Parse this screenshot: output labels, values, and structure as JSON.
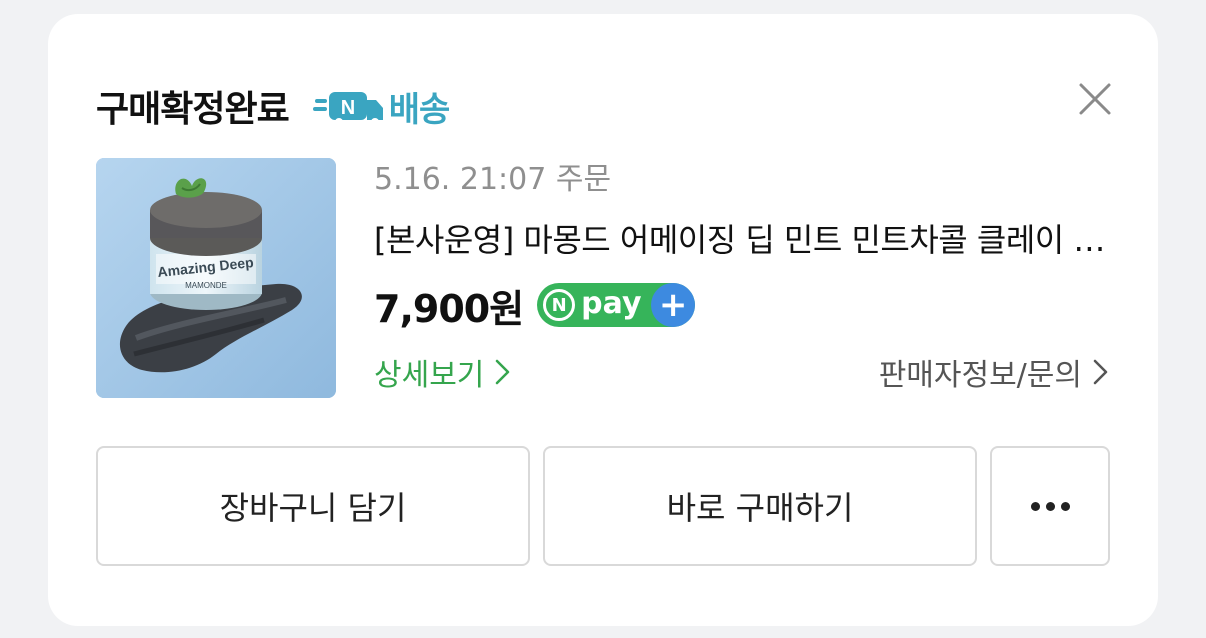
{
  "header": {
    "status_title": "구매확정완료",
    "delivery_badge": {
      "icon": "n-delivery-truck-icon",
      "letter": "N",
      "label": "배송",
      "color": "#3aa5c1"
    },
    "close_icon": "close-icon"
  },
  "product": {
    "image_label": "Amazing Deep",
    "image_brand": "MAMONDE",
    "order_meta": "5.16. 21:07 주문",
    "name": "[본사운영] 마몽드 어메이징 딥 민트 민트차콜 클레이 마스크",
    "price": "7,900원",
    "npay": {
      "letter": "N",
      "text": "pay",
      "plus": "+",
      "green": "#36b45a",
      "blue": "#3d8ae0"
    }
  },
  "links": {
    "detail": "상세보기",
    "detail_color": "#35a54d",
    "seller": "판매자정보/문의"
  },
  "actions": {
    "cart": "장바구니 담기",
    "buy_now": "바로 구매하기",
    "more_icon": "more-dots-icon"
  }
}
